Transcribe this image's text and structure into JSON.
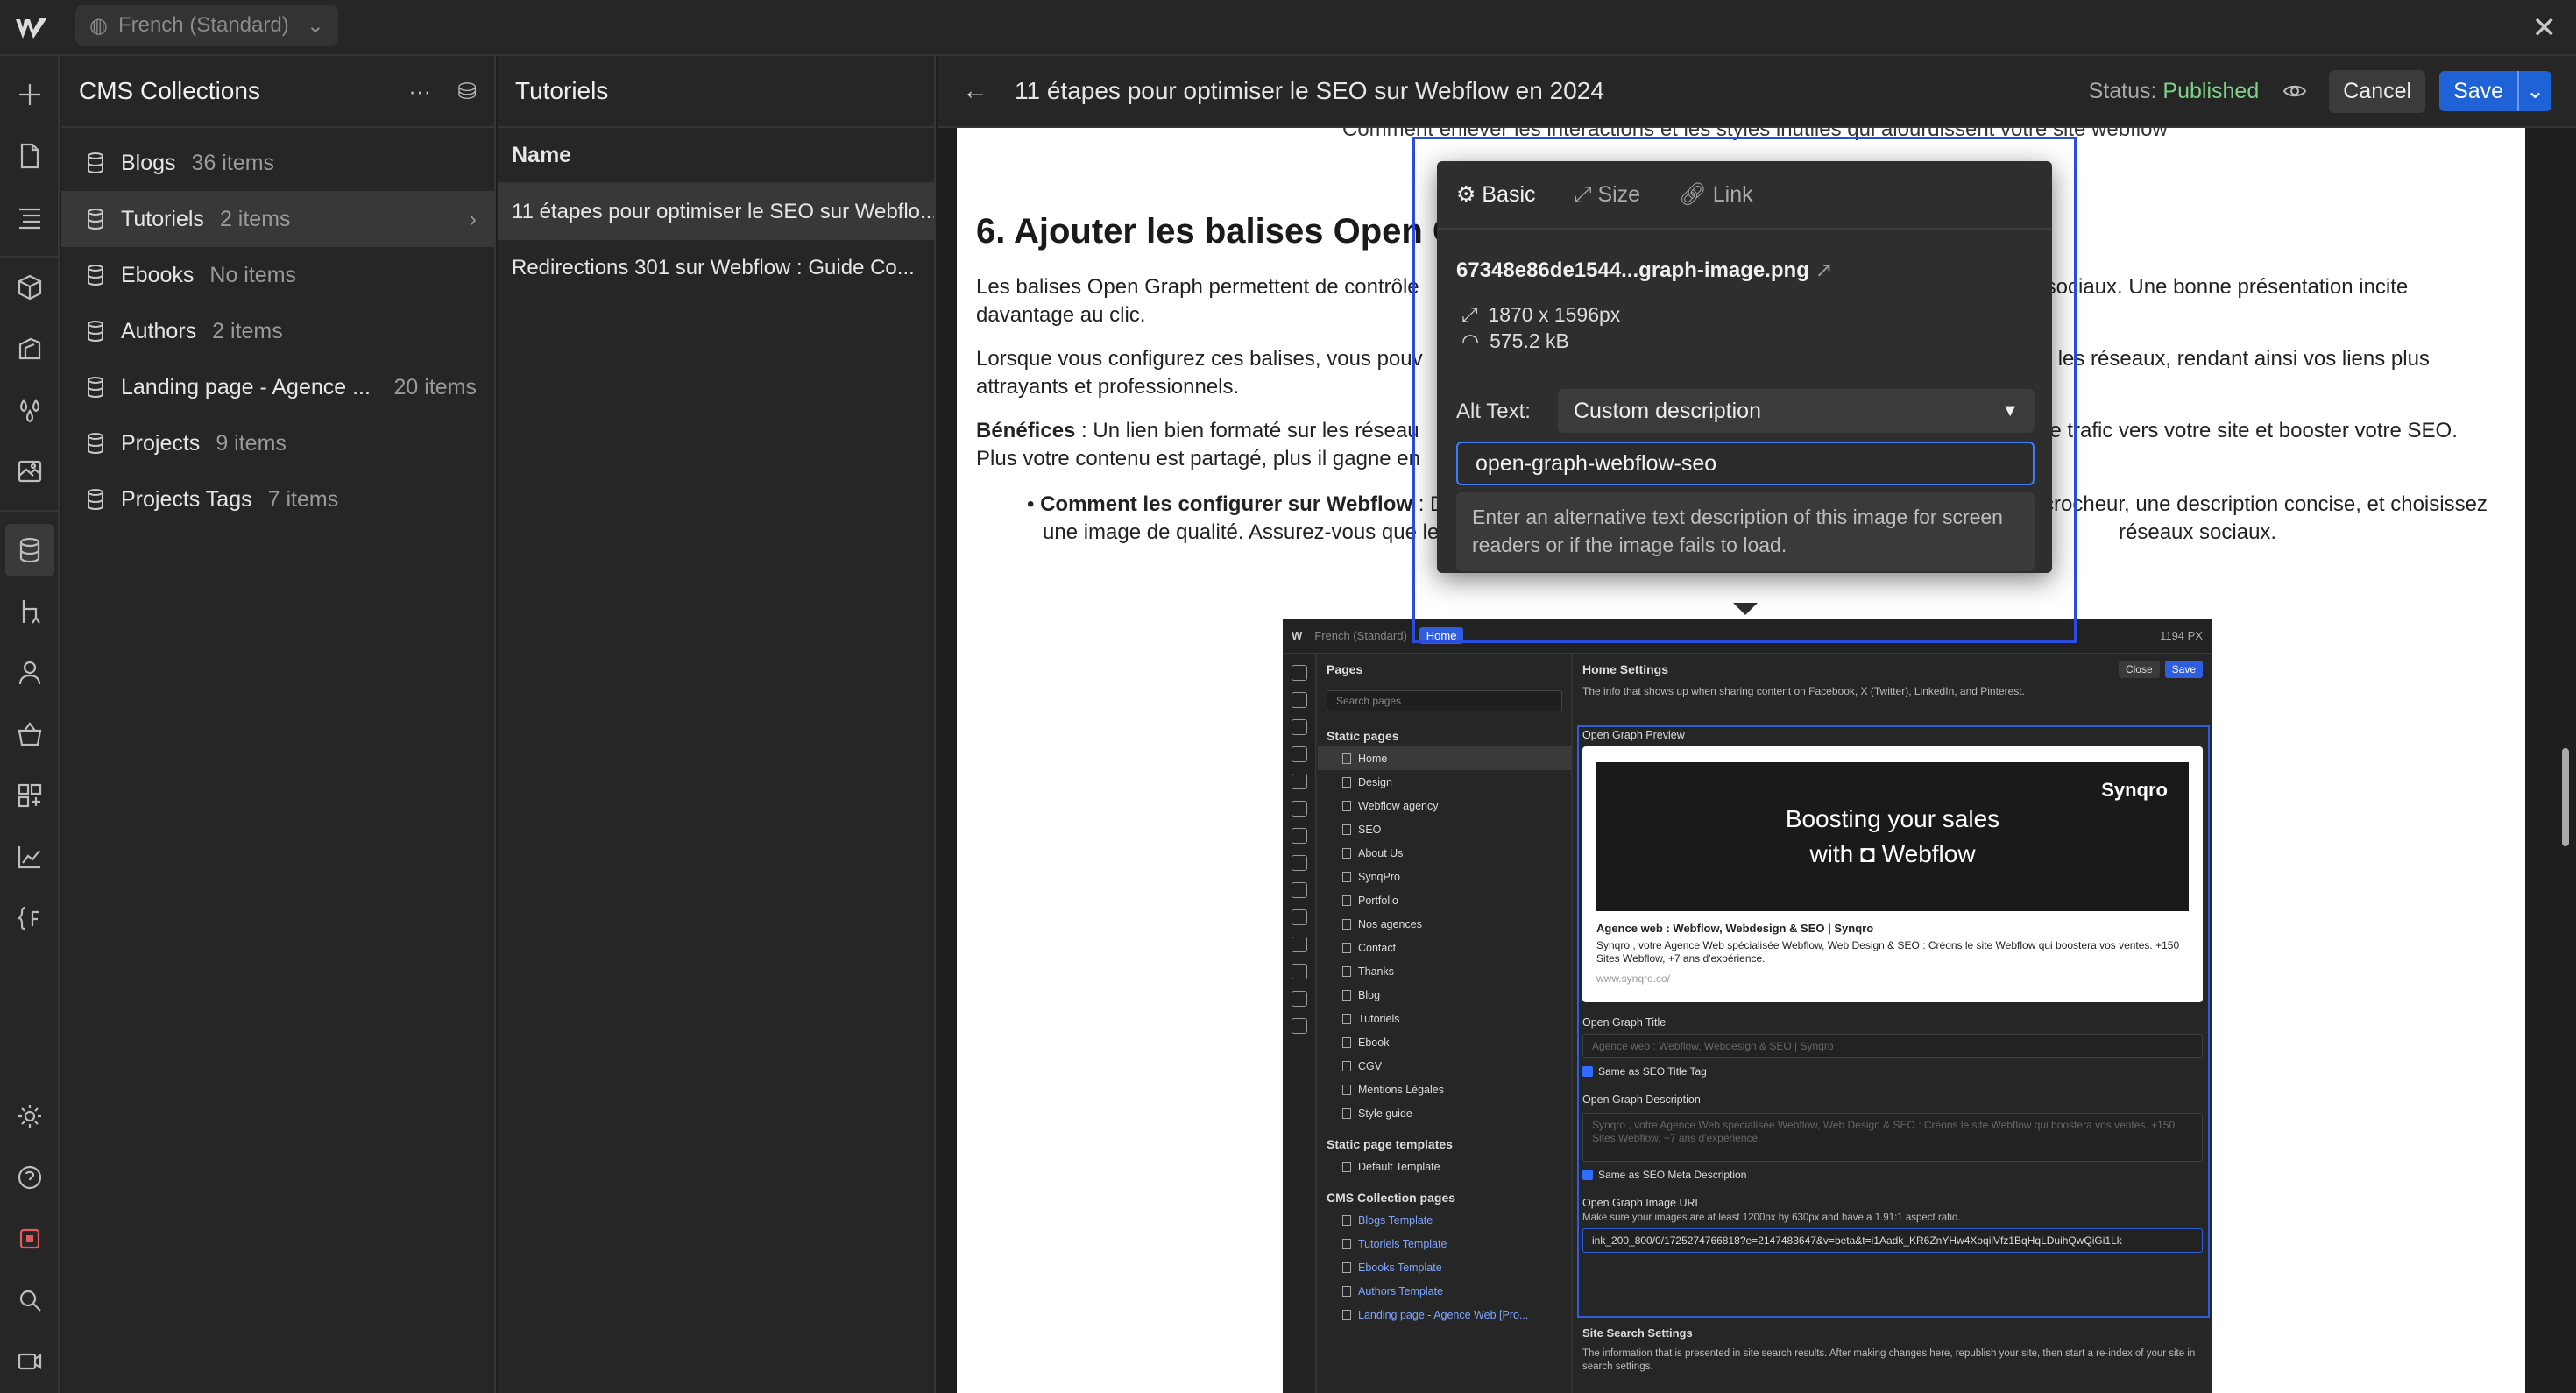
{
  "topbar": {
    "locale": "French (Standard)"
  },
  "cms_panel": {
    "title": "CMS Collections",
    "collections": [
      {
        "name": "Blogs",
        "count": "36 items"
      },
      {
        "name": "Tutoriels",
        "count": "2 items"
      },
      {
        "name": "Ebooks",
        "count": "No items"
      },
      {
        "name": "Authors",
        "count": "2 items"
      },
      {
        "name": "Landing page - Agence ...",
        "count": "20 items"
      },
      {
        "name": "Projects",
        "count": "9 items"
      },
      {
        "name": "Projects Tags",
        "count": "7 items"
      }
    ]
  },
  "items_panel": {
    "title": "Tutoriels",
    "column": "Name",
    "rows": [
      "11 étapes pour optimiser le SEO sur Webflo...",
      "Redirections 301 sur Webflow : Guide Co..."
    ]
  },
  "editor": {
    "title": "11 étapes pour optimiser le SEO sur Webflow en 2024",
    "status_label": "Status:",
    "status_value": "Published",
    "cancel": "Cancel",
    "save": "Save",
    "doc": {
      "cut_line": "Comment enlever les interactions et les styles inutiles qui alourdissent votre site webflow",
      "heading": "6. Ajouter les balises Open G",
      "p1a": "Les balises Open Graph permettent de contrôle",
      "p1b": "x sociaux. Une bonne présentation incite",
      "p1c": "davantage au clic.",
      "p2a": "Lorsque vous configurez ces balises, vous pouv",
      "p2b": "nt sur les réseaux, rendant ainsi vos liens plus",
      "p2c": "attrayants et professionnels.",
      "p3_bold": "Bénéfices",
      "p3a": " : Un lien bien formaté sur les réseau",
      "p3b": "er le trafic vers votre site et booster votre SEO.",
      "p3c": "Plus votre contenu est partagé, plus il gagne en",
      "b_bold": "Comment les configurer sur Webflow",
      "b_a": " : Da",
      "b_b": "ccrocheur, une description concise, et choisissez",
      "b_c": "une image de qualité. Assurez-vous que le",
      "b_d": "réseaux sociaux."
    }
  },
  "popover": {
    "tabs": [
      "Basic",
      "Size",
      "Link"
    ],
    "filename": "67348e86de1544...graph-image.png",
    "dimensions": "1870 x 1596px",
    "filesize": "575.2 kB",
    "alt_label": "Alt Text:",
    "alt_mode": "Custom description",
    "alt_value": "open-graph-webflow-seo",
    "hint": "Enter an alternative text description of this image for screen readers or if the image fails to load."
  },
  "embedded": {
    "locale": "French (Standard)",
    "home_chip": "Home",
    "px": "1194 PX",
    "pages_title": "Pages",
    "search": "Search pages",
    "static_title": "Static pages",
    "static_pages": [
      "Home",
      "Design",
      "Webflow agency",
      "SEO",
      "About Us",
      "SynqPro",
      "Portfolio",
      "Nos agences",
      "Contact",
      "Thanks",
      "Blog",
      "Tutoriels",
      "Ebook",
      "CGV",
      "Mentions Légales",
      "Style guide"
    ],
    "templates_title": "Static page templates",
    "templates": [
      "Default Template"
    ],
    "cms_title": "CMS Collection pages",
    "cms_pages": [
      "Blogs Template",
      "Tutoriels Template",
      "Ebooks Template",
      "Authors Template",
      "Landing page - Agence Web [Pro..."
    ],
    "settings_title": "Home Settings",
    "close": "Close",
    "save": "Save",
    "settings_info": "The info that shows up when sharing content on Facebook, X (Twitter), LinkedIn, and Pinterest.",
    "og_preview": "Open Graph Preview",
    "og_img_line1": "Boosting your sales",
    "og_img_line2": "with ◘ Webflow",
    "og_brand": "Synqro",
    "og_title": "Agence web : Webflow, Webdesign & SEO | Synqro",
    "og_desc": "Synqro , votre Agence Web spécialisée Webflow, Web Design & SEO : Créons le site Webflow qui boostera vos ventes. +150 Sites Webflow, +7 ans d'expérience.",
    "og_url": "www.synqro.co/",
    "og_title_label": "Open Graph Title",
    "og_title_ph": "Agence web : Webflow, Webdesign & SEO | Synqro",
    "same_title": "Same as SEO Title Tag",
    "og_desc_label": "Open Graph Description",
    "og_desc_ph": "Synqro , votre Agence Web spécialisée Webflow, Web Design & SEO : Créons le site Webflow qui boostera vos ventes. +150 Sites Webflow, +7 ans d'expérience.",
    "same_desc": "Same as SEO Meta Description",
    "og_img_label": "Open Graph Image URL",
    "og_img_hint": "Make sure your images are at least 1200px by 630px and have a 1.91:1 aspect ratio.",
    "og_img_url": "ink_200_800/0/1725274766818?e=2147483647&v=beta&t=i1Aadk_KR6ZnYHw4XoqiiVfz1BqHqLDuihQwQiGi1Lk",
    "site_search": "Site Search Settings",
    "site_search_info": "The information that is presented in site search results. After making changes here, republish your site, then start a re-index of your site in search settings."
  }
}
